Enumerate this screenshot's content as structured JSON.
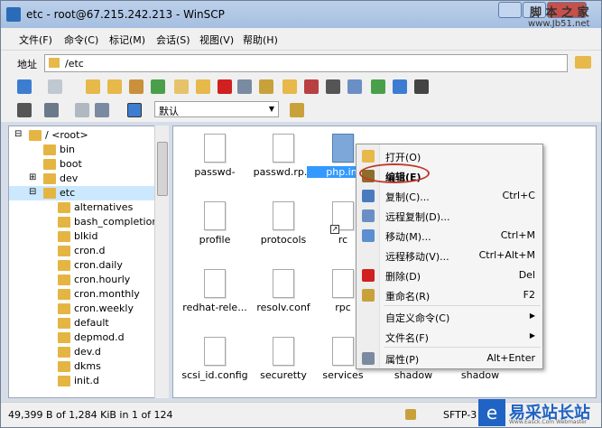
{
  "window": {
    "title": "etc - root@67.215.242.213 - WinSCP",
    "watermark_top": "脚 本 之 家",
    "watermark_url": "www.Jb51.net"
  },
  "menu": [
    "文件(F)",
    "命令(C)",
    "标记(M)",
    "会话(S)",
    "视图(V)",
    "帮助(H)"
  ],
  "address": {
    "label": "地址",
    "path": "/etc"
  },
  "toolbar": {
    "transfer_setting": "默认"
  },
  "tree": {
    "items": [
      {
        "label": "/ <root>",
        "indent": 0,
        "expand": "-"
      },
      {
        "label": "bin",
        "indent": 1,
        "expand": ""
      },
      {
        "label": "boot",
        "indent": 1,
        "expand": ""
      },
      {
        "label": "dev",
        "indent": 1,
        "expand": "+"
      },
      {
        "label": "etc",
        "indent": 1,
        "expand": "-",
        "selected": true
      },
      {
        "label": "alternatives",
        "indent": 2,
        "expand": ""
      },
      {
        "label": "bash_completion",
        "indent": 2,
        "expand": ""
      },
      {
        "label": "blkid",
        "indent": 2,
        "expand": ""
      },
      {
        "label": "cron.d",
        "indent": 2,
        "expand": ""
      },
      {
        "label": "cron.daily",
        "indent": 2,
        "expand": ""
      },
      {
        "label": "cron.hourly",
        "indent": 2,
        "expand": ""
      },
      {
        "label": "cron.monthly",
        "indent": 2,
        "expand": ""
      },
      {
        "label": "cron.weekly",
        "indent": 2,
        "expand": ""
      },
      {
        "label": "default",
        "indent": 2,
        "expand": ""
      },
      {
        "label": "depmod.d",
        "indent": 2,
        "expand": ""
      },
      {
        "label": "dev.d",
        "indent": 2,
        "expand": ""
      },
      {
        "label": "dkms",
        "indent": 2,
        "expand": ""
      },
      {
        "label": "init.d",
        "indent": 2,
        "expand": ""
      }
    ]
  },
  "files": [
    {
      "label": "passwd-"
    },
    {
      "label": "passwd.rp..."
    },
    {
      "label": "php.ini",
      "selected": true,
      "gear": true
    },
    {
      "label": "profile"
    },
    {
      "label": "protocols"
    },
    {
      "label": "rc",
      "link": true
    },
    {
      "label": "redhat-rele..."
    },
    {
      "label": "resolv.conf"
    },
    {
      "label": "rpc"
    },
    {
      "label": "scsi_id.config"
    },
    {
      "label": "securetty"
    },
    {
      "label": "services"
    },
    {
      "label": "shadow"
    },
    {
      "label": "shadow"
    }
  ],
  "context_menu": {
    "items": [
      {
        "label": "打开(O)",
        "shortcut": "",
        "icon": "open-icon",
        "color": "#e7b84a"
      },
      {
        "label": "编辑(E)",
        "shortcut": "",
        "icon": "edit-icon",
        "color": "#8c6d2a",
        "bold": true
      },
      {
        "label": "复制(C)...",
        "shortcut": "Ctrl+C",
        "icon": "copy-icon",
        "color": "#4a7bbf"
      },
      {
        "label": "远程复制(D)...",
        "shortcut": "",
        "icon": "remote-copy-icon",
        "color": "#6a8fc4"
      },
      {
        "label": "移动(M)...",
        "shortcut": "Ctrl+M",
        "icon": "move-icon",
        "color": "#5b8fcf"
      },
      {
        "label": "远程移动(V)...",
        "shortcut": "Ctrl+Alt+M",
        "icon": "",
        "color": ""
      },
      {
        "label": "删除(D)",
        "shortcut": "Del",
        "icon": "delete-icon",
        "color": "#d02020"
      },
      {
        "label": "重命名(R)",
        "shortcut": "F2",
        "icon": "rename-icon",
        "color": "#c9a13a"
      },
      {
        "label": "自定义命令(C)",
        "shortcut": "",
        "icon": "",
        "color": "",
        "submenu": true
      },
      {
        "label": "文件名(F)",
        "shortcut": "",
        "icon": "",
        "color": "",
        "submenu": true
      },
      {
        "label": "属性(P)",
        "shortcut": "Alt+Enter",
        "icon": "properties-icon",
        "color": "#7a8aa0"
      }
    ]
  },
  "status": {
    "left": "49,399 B of 1,284 KiB in 1 of 124",
    "protocol": "SFTP-3"
  },
  "watermark_bottom": {
    "logo": "e",
    "text": "易采站长站",
    "sub": "Www.Easck.Com Webmaster"
  }
}
